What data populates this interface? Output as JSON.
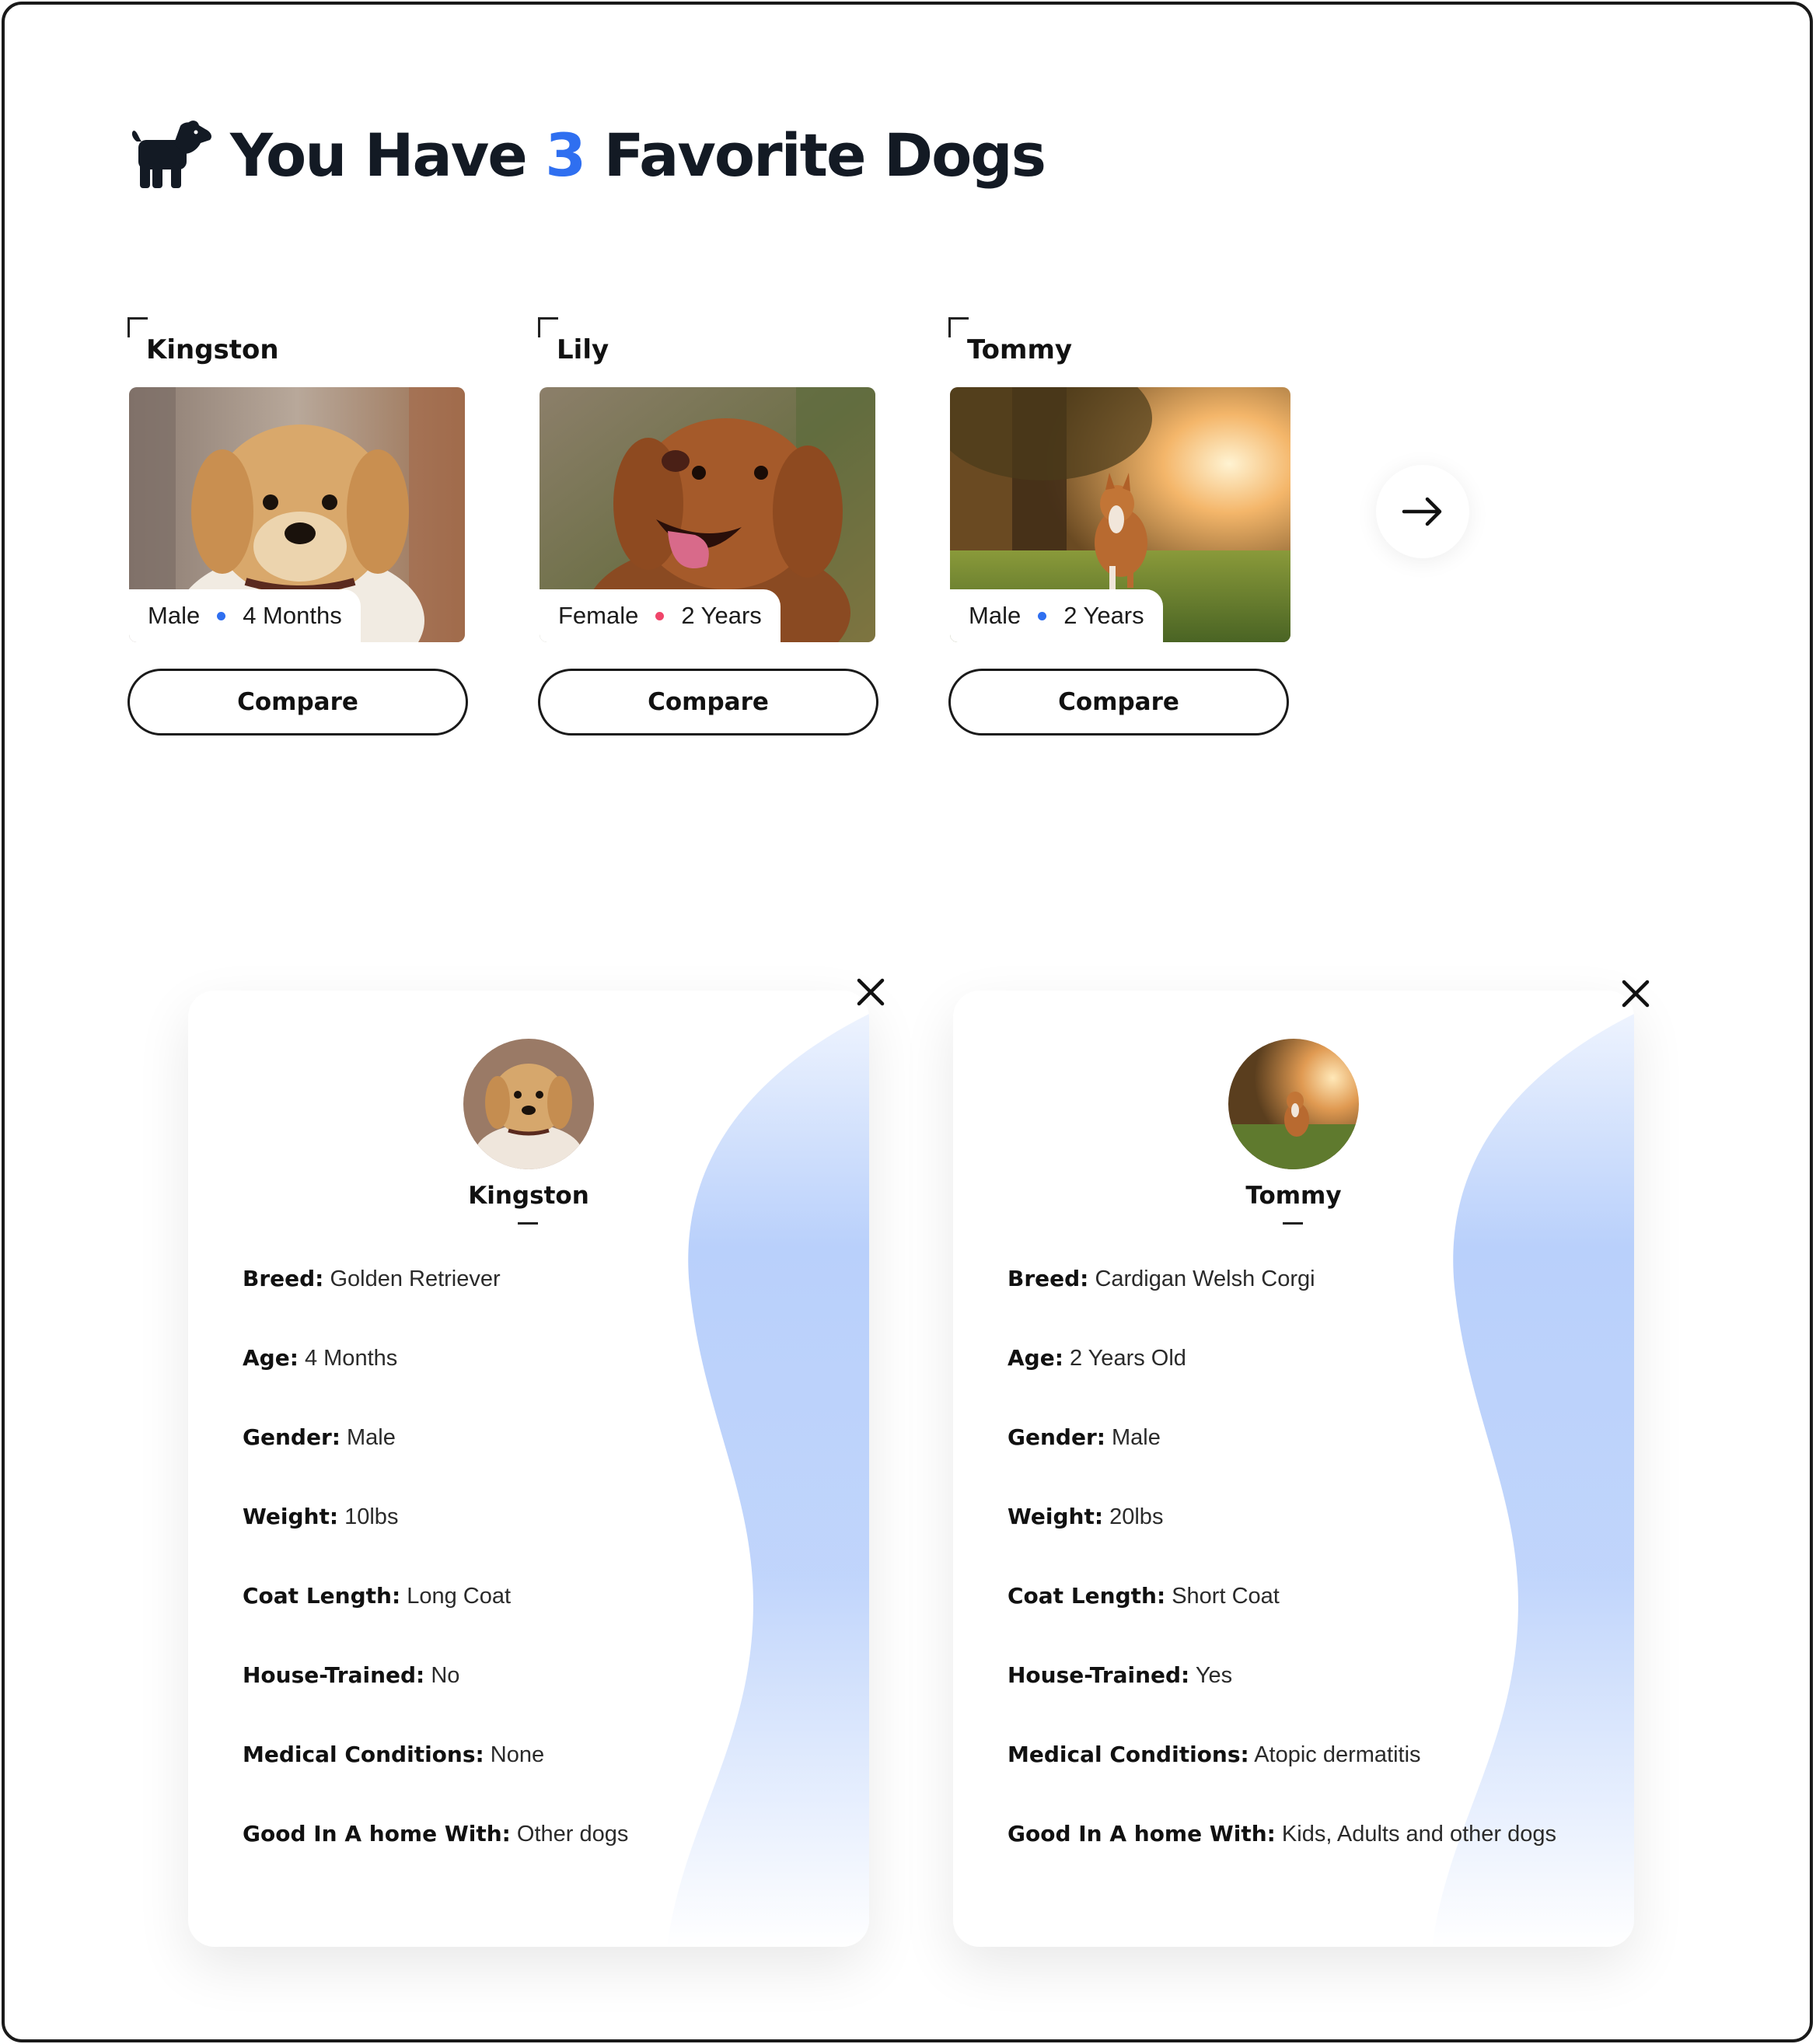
{
  "header": {
    "prefix": "You Have",
    "count": "3",
    "suffix": "Favorite Dogs"
  },
  "favorites": [
    {
      "name": "Kingston",
      "gender": "Male",
      "age": "4 Months",
      "dot_color": "#2f6ff0",
      "compare_label": "Compare"
    },
    {
      "name": "Lily",
      "gender": "Female",
      "age": "2 Years",
      "dot_color": "#f0456a",
      "compare_label": "Compare"
    },
    {
      "name": "Tommy",
      "gender": "Male",
      "age": "2 Years",
      "dot_color": "#2f6ff0",
      "compare_label": "Compare"
    }
  ],
  "comparison": [
    {
      "name": "Kingston",
      "rows": [
        {
          "label": "Breed:",
          "value": "Golden Retriever"
        },
        {
          "label": "Age:",
          "value": "4 Months"
        },
        {
          "label": "Gender:",
          "value": "Male"
        },
        {
          "label": "Weight:",
          "value": "10lbs"
        },
        {
          "label": "Coat Length:",
          "value": "Long Coat"
        },
        {
          "label": "House-Trained:",
          "value": "No"
        },
        {
          "label": "Medical Conditions:",
          "value": "None"
        },
        {
          "label": "Good In A home With:",
          "value": "Other dogs"
        }
      ]
    },
    {
      "name": "Tommy",
      "rows": [
        {
          "label": "Breed:",
          "value": "Cardigan Welsh Corgi"
        },
        {
          "label": "Age:",
          "value": "2 Years Old"
        },
        {
          "label": "Gender:",
          "value": "Male"
        },
        {
          "label": "Weight:",
          "value": "20lbs"
        },
        {
          "label": "Coat Length:",
          "value": "Short Coat"
        },
        {
          "label": "House-Trained:",
          "value": "Yes"
        },
        {
          "label": "Medical Conditions:",
          "value": "Atopic dermatitis"
        },
        {
          "label": "Good In A home With:",
          "value": "Kids, Adults and other dogs"
        }
      ]
    }
  ],
  "icons": {
    "header": "dog-icon",
    "next": "arrow-right-icon",
    "close": "close-icon"
  },
  "colors": {
    "accent": "#2f6ff0",
    "female_dot": "#f0456a",
    "blob": "#b9d0fb"
  }
}
